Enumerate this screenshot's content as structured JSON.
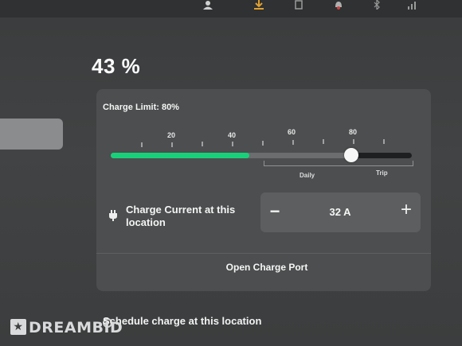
{
  "battery": {
    "percent_label": "43 %"
  },
  "charge_limit": {
    "label": "Charge Limit: 80%",
    "limit_percent": 80,
    "current_fill_percent": 46,
    "scale_labels": [
      "20",
      "40",
      "60",
      "80"
    ],
    "range_labels": {
      "daily": "Daily",
      "trip": "Trip"
    },
    "colors": {
      "fill": "#19d07a",
      "track": "#6b6d6e",
      "above_limit": "#1e1f20"
    }
  },
  "charge_current": {
    "label": "Charge Current at this location",
    "value": "32 A",
    "minus_symbol": "−",
    "plus_symbol": "+",
    "icon": "plug-icon"
  },
  "open_charge_port": {
    "label": "Open Charge Port"
  },
  "schedule": {
    "label": "Schedule charge at this location"
  },
  "watermark": {
    "text": "DREAMBID",
    "glyph": "★"
  },
  "topbar_icons": [
    "profile-icon",
    "download-icon",
    "mode-icon",
    "alarm-icon",
    "bluetooth-icon",
    "signal-icon"
  ]
}
